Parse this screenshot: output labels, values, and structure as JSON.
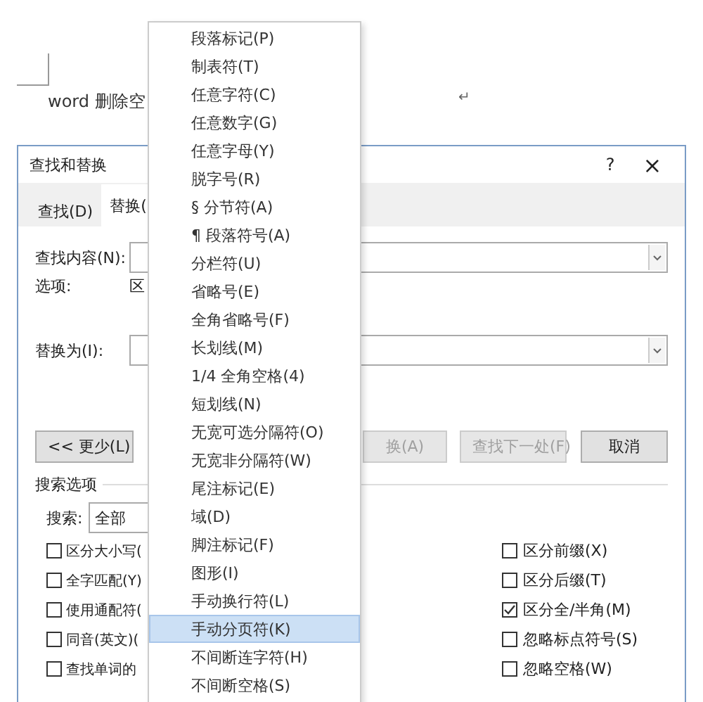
{
  "document": {
    "text": "word 删除空",
    "paragraph_mark": "↵"
  },
  "dialog": {
    "title": "查找和替换",
    "help": "?",
    "close": "×",
    "tabs": [
      {
        "label": "查找(D)",
        "selected": false
      },
      {
        "label": "替换(",
        "selected": true
      }
    ],
    "find": {
      "label": "查找内容(N):"
    },
    "options": {
      "label": "选项:",
      "value": "区"
    },
    "replace": {
      "label": "替换为(I):"
    },
    "buttons": [
      {
        "label": "<< 更少(L)",
        "disabled": false
      },
      {
        "label": "换(A)",
        "disabled": true
      },
      {
        "label": "查找下一处(F)",
        "disabled": true
      },
      {
        "label": "取消",
        "disabled": false
      }
    ],
    "search_options": {
      "title": "搜索选项",
      "search_label": "搜索:",
      "search_value": "全部"
    },
    "left_checks": [
      {
        "label": "区分大小写(",
        "checked": false
      },
      {
        "label": "全字匹配(Y)",
        "checked": false
      },
      {
        "label": "使用通配符(",
        "checked": false
      },
      {
        "label": "同音(英文)(",
        "checked": false
      },
      {
        "label": "查找单词的",
        "checked": false
      }
    ],
    "right_checks": [
      {
        "label": "区分前缀(X)",
        "checked": false
      },
      {
        "label": "区分后缀(T)",
        "checked": false
      },
      {
        "label": "区分全/半角(M)",
        "checked": true
      },
      {
        "label": "忽略标点符号(S)",
        "checked": false
      },
      {
        "label": "忽略空格(W)",
        "checked": false
      }
    ]
  },
  "menu": [
    {
      "label": "段落标记(P)",
      "selected": false
    },
    {
      "label": "制表符(T)",
      "selected": false
    },
    {
      "label": "任意字符(C)",
      "selected": false
    },
    {
      "label": "任意数字(G)",
      "selected": false
    },
    {
      "label": "任意字母(Y)",
      "selected": false
    },
    {
      "label": "脱字号(R)",
      "selected": false
    },
    {
      "label": "§ 分节符(A)",
      "selected": false
    },
    {
      "label": "¶ 段落符号(A)",
      "selected": false
    },
    {
      "label": "分栏符(U)",
      "selected": false
    },
    {
      "label": "省略号(E)",
      "selected": false
    },
    {
      "label": "全角省略号(F)",
      "selected": false
    },
    {
      "label": "长划线(M)",
      "selected": false
    },
    {
      "label": "1/4 全角空格(4)",
      "selected": false
    },
    {
      "label": "短划线(N)",
      "selected": false
    },
    {
      "label": "无宽可选分隔符(O)",
      "selected": false
    },
    {
      "label": "无宽非分隔符(W)",
      "selected": false
    },
    {
      "label": "尾注标记(E)",
      "selected": false
    },
    {
      "label": "域(D)",
      "selected": false
    },
    {
      "label": "脚注标记(F)",
      "selected": false
    },
    {
      "label": "图形(I)",
      "selected": false
    },
    {
      "label": "手动换行符(L)",
      "selected": false
    },
    {
      "label": "手动分页符(K)",
      "selected": true
    },
    {
      "label": "不间断连字符(H)",
      "selected": false
    },
    {
      "label": "不间断空格(S)",
      "selected": false
    }
  ]
}
